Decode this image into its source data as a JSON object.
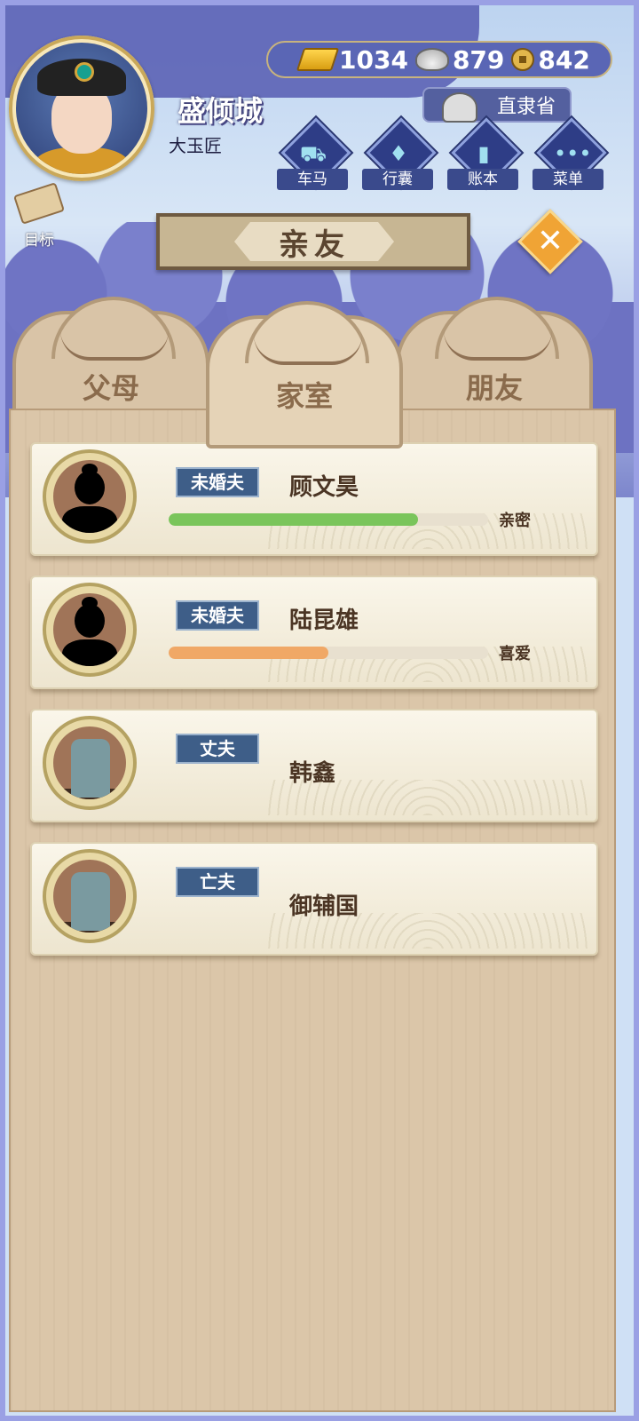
{
  "player": {
    "name": "盛倾城",
    "title": "大玉匠"
  },
  "goal": {
    "label": "目标",
    "icon": "scroll-icon"
  },
  "currency": {
    "gold": "1034",
    "silver": "879",
    "coin": "842"
  },
  "province": {
    "label": "直隶省",
    "icon": "official-hat-icon"
  },
  "menu": {
    "items": [
      {
        "label": "车马",
        "icon": "carriage-icon"
      },
      {
        "label": "行囊",
        "icon": "bag-icon"
      },
      {
        "label": "账本",
        "icon": "ledger-icon"
      },
      {
        "label": "菜单",
        "icon": "more-icon"
      }
    ]
  },
  "banner": {
    "title": "亲友"
  },
  "tabs": [
    {
      "label": "父母",
      "active": false
    },
    {
      "label": "家室",
      "active": true
    },
    {
      "label": "朋友",
      "active": false
    }
  ],
  "relatives": [
    {
      "role": "未婚夫",
      "name": "顾文昊",
      "relation": "亲密",
      "progress": 0.78,
      "bar_color": "#7ac55b",
      "portrait": "silhouette"
    },
    {
      "role": "未婚夫",
      "name": "陆昆雄",
      "relation": "喜爱",
      "progress": 0.5,
      "bar_color": "#f0a866",
      "portrait": "silhouette"
    },
    {
      "role": "丈夫",
      "name": "韩鑫",
      "relation": "",
      "progress": null,
      "bar_color": "",
      "portrait": "tombstone"
    },
    {
      "role": "亡夫",
      "name": "御辅国",
      "relation": "",
      "progress": null,
      "bar_color": "",
      "portrait": "tombstone"
    }
  ]
}
